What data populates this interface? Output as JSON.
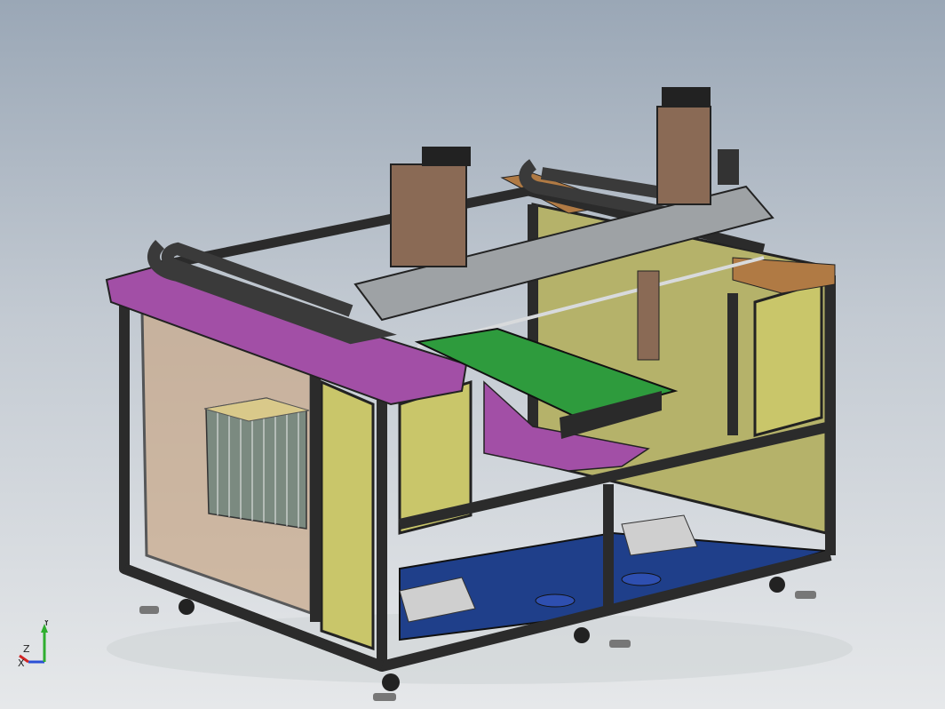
{
  "viewport": {
    "background_top": "#9aa7b6",
    "background_bottom": "#e6e8ea"
  },
  "model": {
    "frame_color": "#2b2b2b",
    "panel_color": "#c9c66a",
    "top_plate_color": "#a24fa6",
    "rail_color": "#9ea2a5",
    "belt_color": "#3a3a3a",
    "pcb_color": "#2e9b3d",
    "floor_color": "#1f3f8a",
    "wood_color": "#b07a44"
  },
  "triad": {
    "y_label": "Y",
    "z_label": "Z",
    "x_label": "X",
    "y_color": "#2fae2f",
    "x_color": "#d12424",
    "z_color": "#2a4fd6"
  }
}
